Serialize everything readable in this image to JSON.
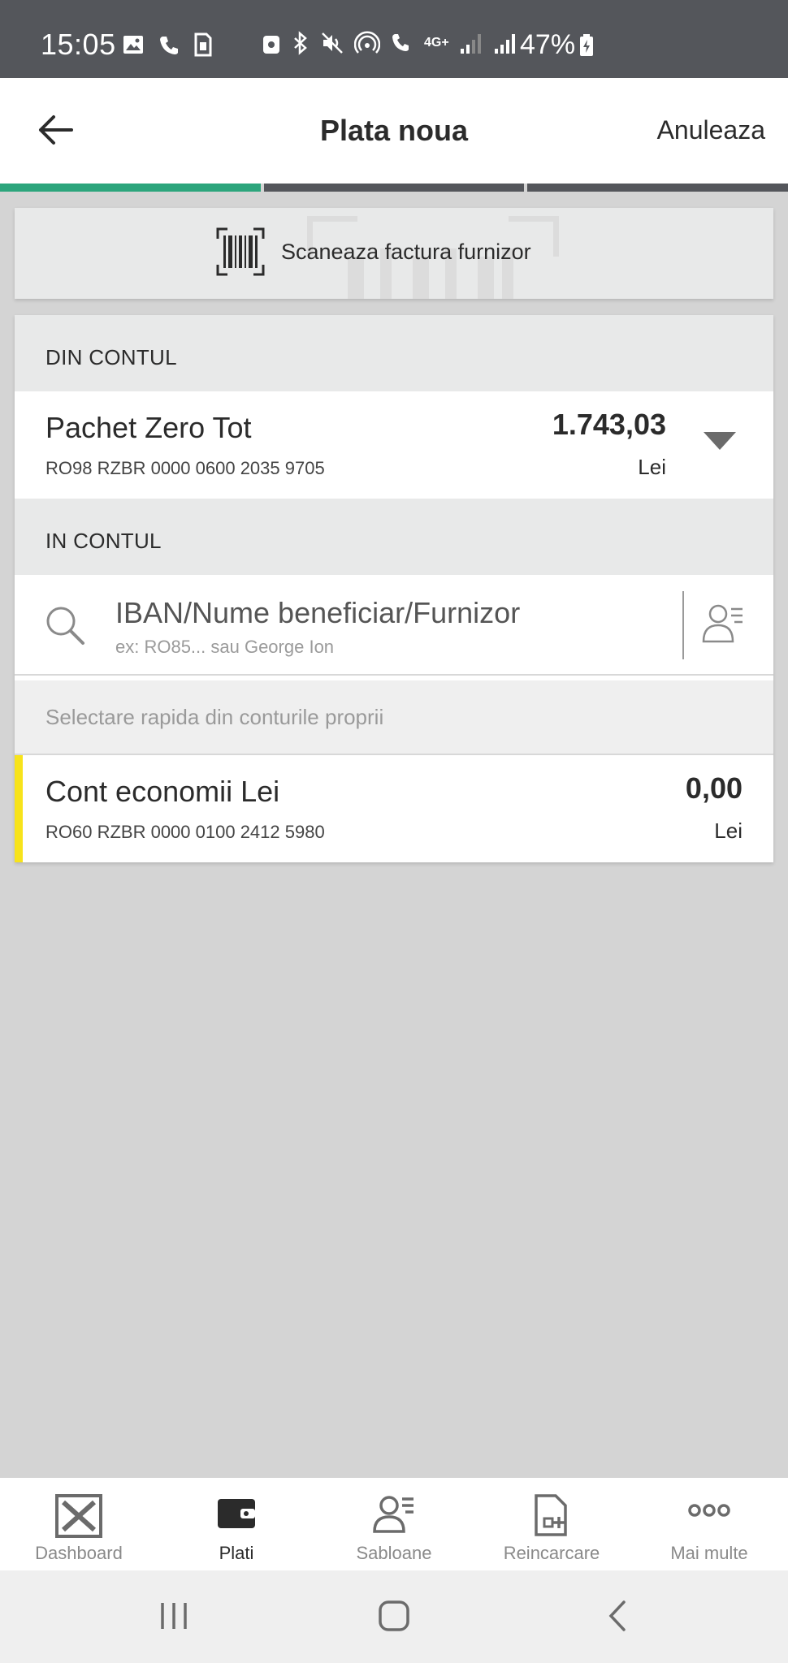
{
  "status_bar": {
    "time": "15:05",
    "network": "4G+",
    "battery": "47%"
  },
  "header": {
    "title": "Plata noua",
    "cancel_label": "Anuleaza",
    "back_icon": "arrow-left-icon"
  },
  "progress": {
    "current_step": 1,
    "total_steps": 3,
    "active_color": "#2ca57c"
  },
  "scan": {
    "label": "Scaneaza factura furnizor",
    "icon": "barcode-icon"
  },
  "from_account": {
    "section_label": "DIN CONTUL",
    "name": "Pachet Zero Tot",
    "iban": "RO98 RZBR 0000 0600 2035 9705",
    "amount": "1.743,03",
    "currency": "Lei"
  },
  "to_account": {
    "section_label": "IN CONTUL",
    "search_placeholder": "IBAN/Nume beneficiar/Furnizor",
    "search_hint": "ex: RO85... sau George Ion"
  },
  "quick_select": {
    "label": "Selectare rapida din conturile proprii",
    "accounts": [
      {
        "name": "Cont economii Lei",
        "iban": "RO60 RZBR 0000 0100 2412 5980",
        "amount": "0,00",
        "currency": "Lei",
        "stripe_color": "#f7e31b"
      }
    ]
  },
  "bottom_nav": {
    "items": [
      {
        "label": "Dashboard",
        "icon": "dashboard-icon",
        "active": false
      },
      {
        "label": "Plati",
        "icon": "wallet-icon",
        "active": true
      },
      {
        "label": "Sabloane",
        "icon": "templates-icon",
        "active": false
      },
      {
        "label": "Reincarcare",
        "icon": "recharge-icon",
        "active": false
      },
      {
        "label": "Mai multe",
        "icon": "more-icon",
        "active": false
      }
    ]
  }
}
